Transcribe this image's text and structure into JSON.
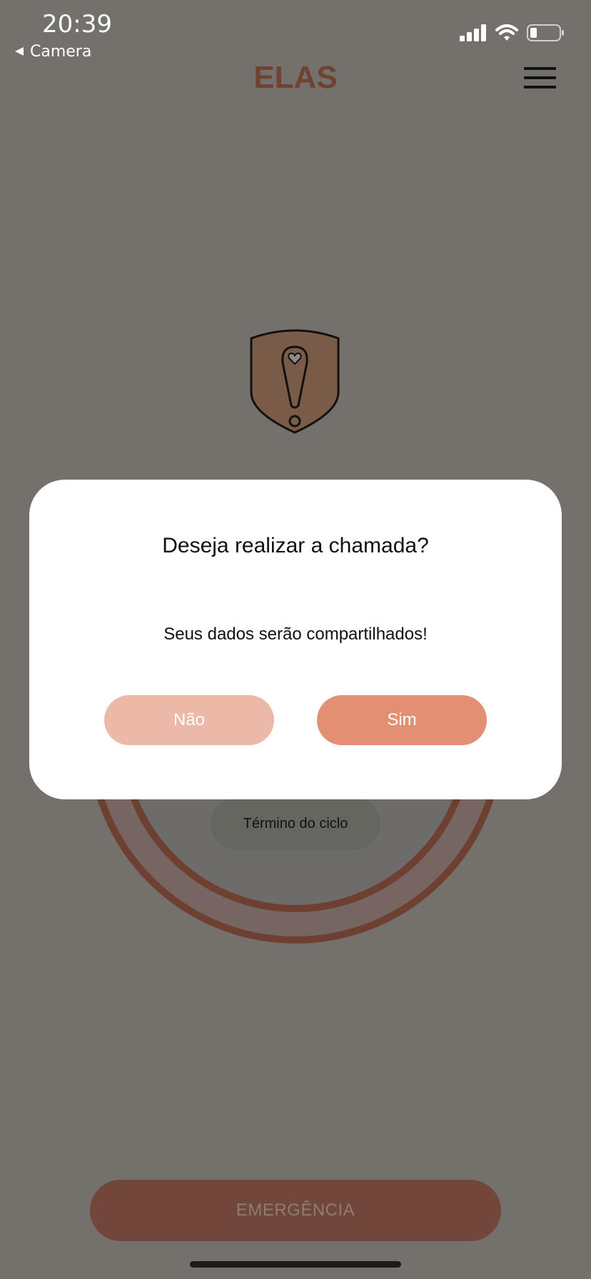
{
  "status_bar": {
    "time": "20:39",
    "back_label": "Camera",
    "icons": [
      "signal-icon",
      "wifi-icon",
      "battery-icon"
    ]
  },
  "header": {
    "title": "ELAS",
    "menu_icon": "hamburger-menu-icon"
  },
  "main": {
    "logo_icon": "shield-alert-icon",
    "cycle_label": "Término do ciclo",
    "emergency_label": "EMERGÊNCIA"
  },
  "dialog": {
    "title": "Deseja realizar a chamada?",
    "message": "Seus dados serão compartilhados!",
    "no_label": "Não",
    "yes_label": "Sim"
  },
  "colors": {
    "overlay_bg": "#74706c",
    "brand": "#6f4232",
    "no_button": "#ecb9a8",
    "yes_button": "#e38f74"
  }
}
